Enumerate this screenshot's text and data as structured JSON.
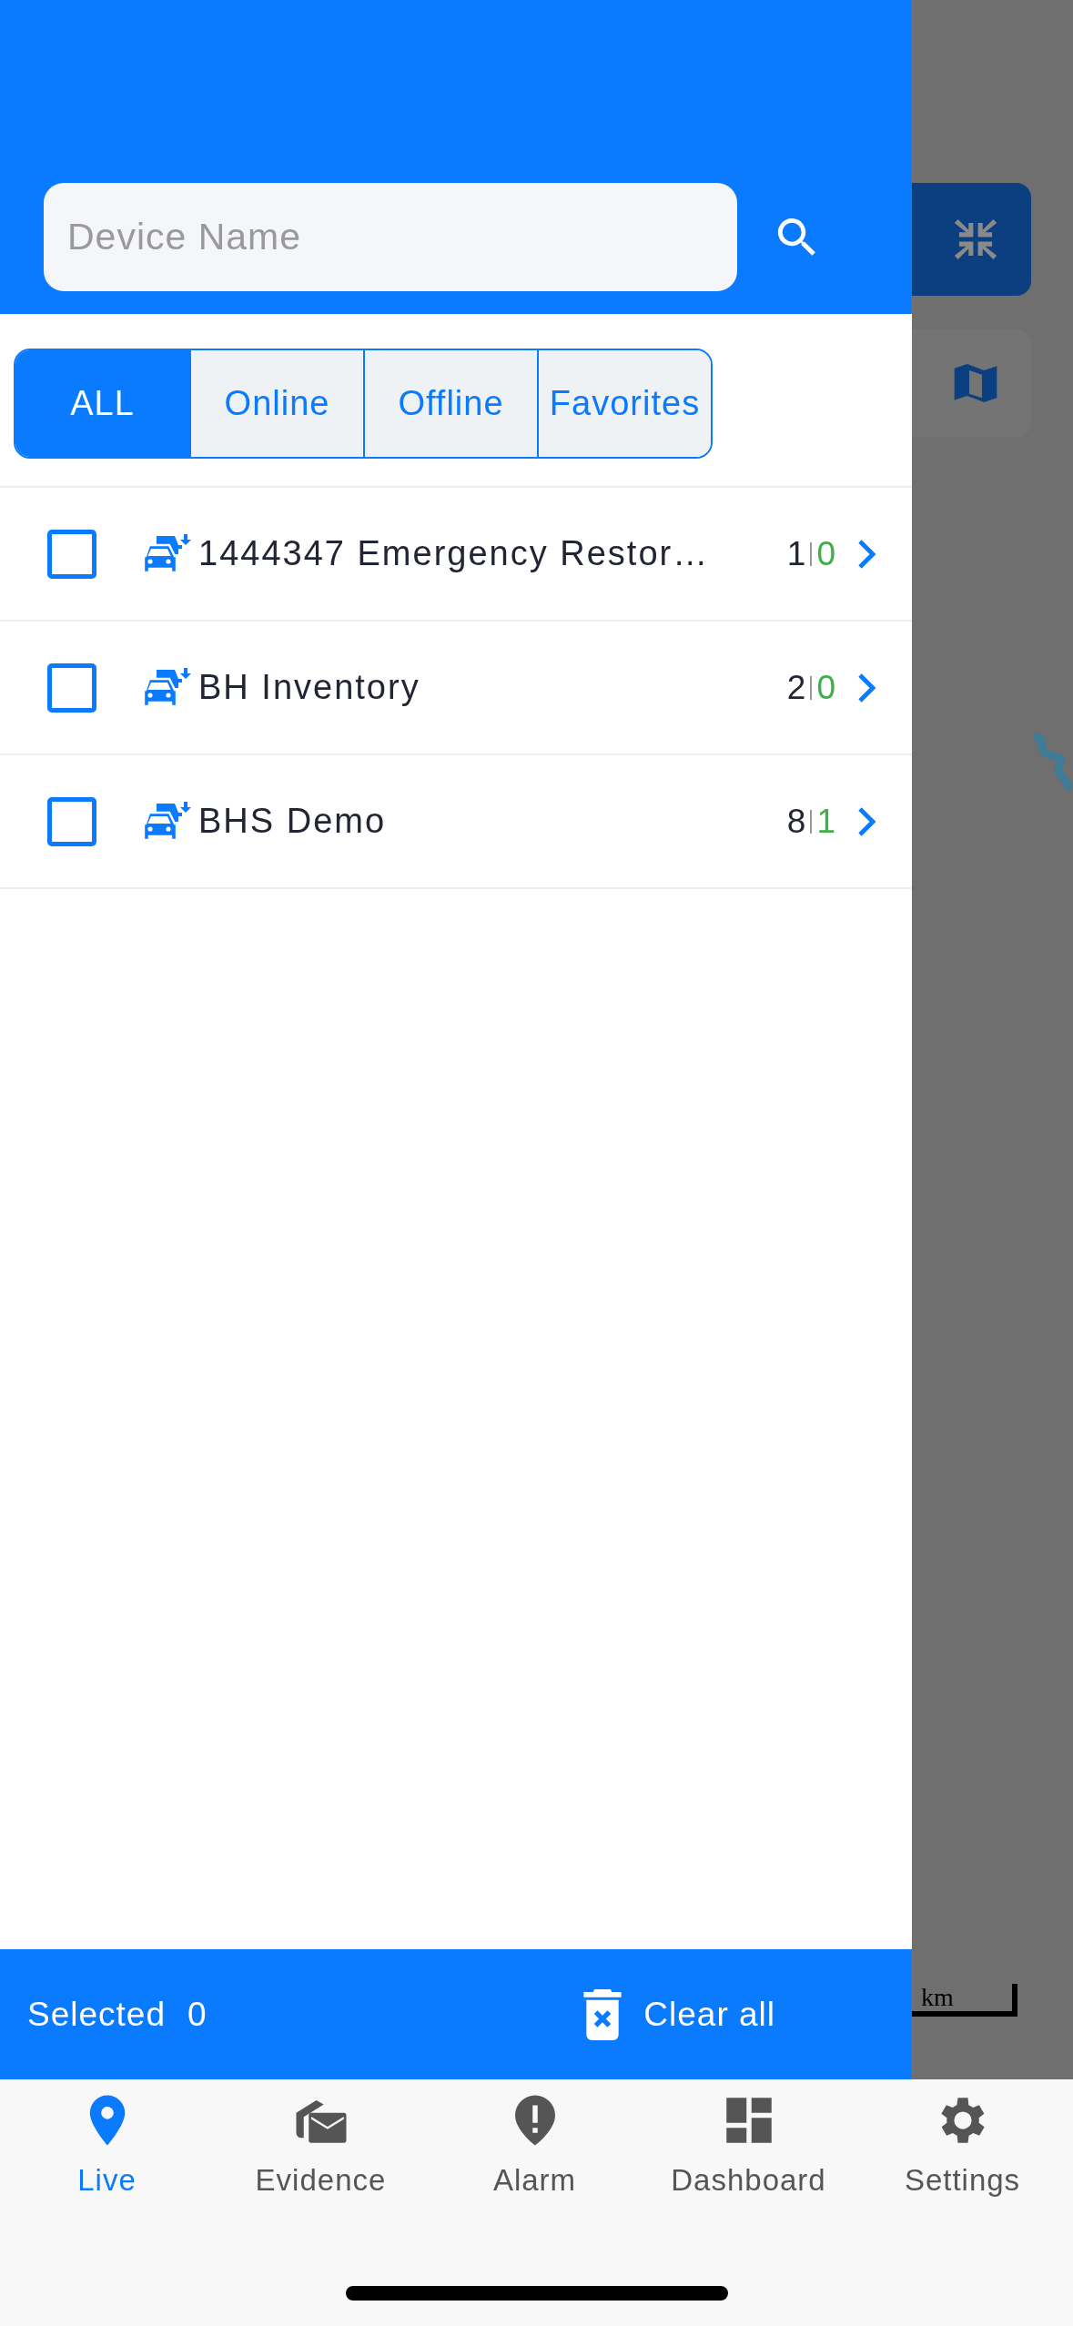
{
  "search": {
    "placeholder": "Device Name"
  },
  "filters": [
    {
      "label": "ALL",
      "selected": true
    },
    {
      "label": "Online",
      "selected": false
    },
    {
      "label": "Offline",
      "selected": false
    },
    {
      "label": "Favorites",
      "selected": false
    }
  ],
  "groups": [
    {
      "name": "1444347 Emergency Restor…",
      "total": "1",
      "online": "0",
      "checked": false
    },
    {
      "name": "BH Inventory",
      "total": "2",
      "online": "0",
      "checked": false
    },
    {
      "name": "BHS Demo",
      "total": "8",
      "online": "1",
      "checked": false
    }
  ],
  "selection_bar": {
    "label": "Selected",
    "count": "0",
    "clear_label": "Clear all"
  },
  "map": {
    "scale_label": "km"
  },
  "tab_bar": [
    {
      "label": "Live",
      "selected": true
    },
    {
      "label": "Evidence",
      "selected": false
    },
    {
      "label": "Alarm",
      "selected": false
    },
    {
      "label": "Dashboard",
      "selected": false
    },
    {
      "label": "Settings",
      "selected": false
    }
  ]
}
